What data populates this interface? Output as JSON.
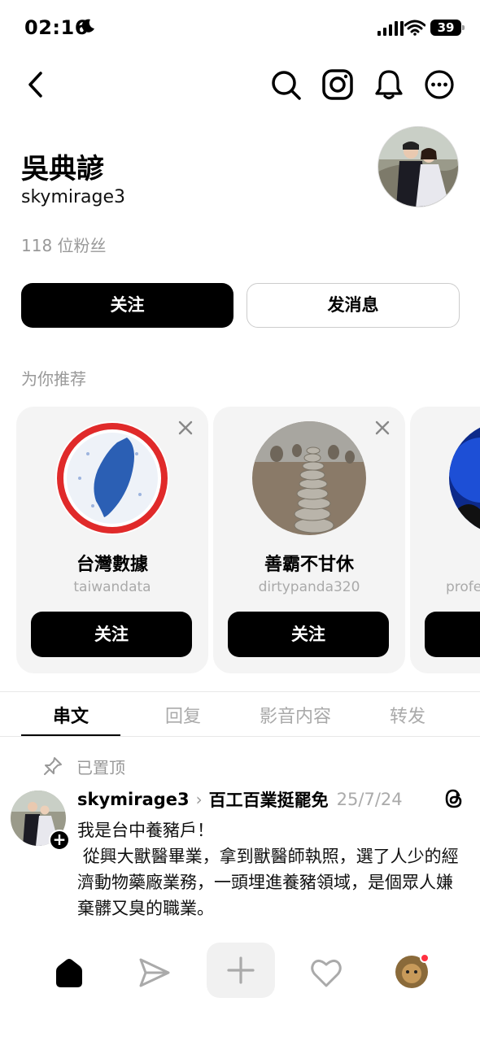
{
  "status": {
    "time": "02:16",
    "battery": "39"
  },
  "profile": {
    "name": "吳典諺",
    "handle": "skymirage3",
    "followers": "118 位粉丝",
    "follow_label": "关注",
    "message_label": "发消息"
  },
  "recommend": {
    "title": "为你推荐",
    "cards": [
      {
        "name": "台灣數據",
        "handle": "taiwandata",
        "button": "关注"
      },
      {
        "name": "善霸不甘休",
        "handle": "dirtypanda320",
        "button": "关注"
      },
      {
        "name": "",
        "handle": "profe",
        "button": ""
      }
    ]
  },
  "tabs": [
    "串文",
    "回复",
    "影音内容",
    "转发"
  ],
  "post": {
    "pinned_label": "已置顶",
    "username": "skymirage3",
    "topic": "百工百業挺罷免",
    "date": "25/7/24",
    "line1": "我是台中養豬戶！",
    "paragraph": " 從興大獸醫畢業，拿到獸醫師執照，選了人少的經濟動物藥廠業務，一頭埋進養豬領域，是個眾人嫌棄髒又臭的職業。"
  },
  "icons": {
    "back": "chevron-left-icon",
    "search": "search-icon",
    "instagram": "instagram-icon",
    "bell": "bell-icon",
    "more": "more-icon",
    "home": "home-icon",
    "send": "send-icon",
    "plus": "plus-icon",
    "heart": "heart-icon",
    "threads": "threads-icon",
    "pin": "pin-icon"
  },
  "colors": {
    "accent": "#000000",
    "muted": "#999999",
    "notification": "#ff3040"
  }
}
